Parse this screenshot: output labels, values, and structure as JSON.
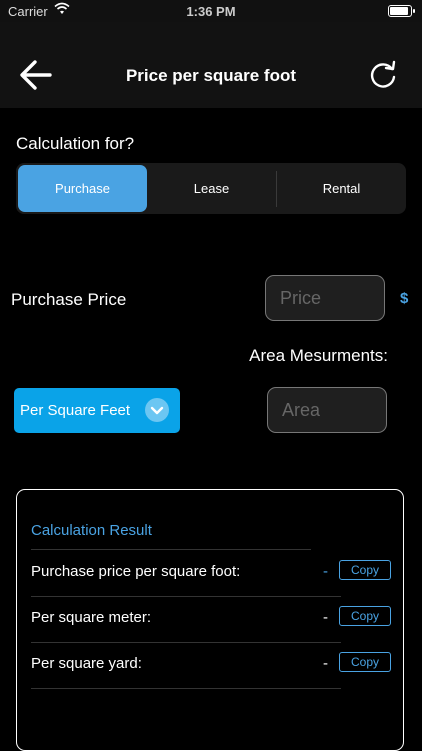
{
  "status_bar": {
    "carrier": "Carrier",
    "time": "1:36 PM"
  },
  "nav": {
    "title": "Price per square foot",
    "back_icon": "arrow-left-icon",
    "refresh_icon": "refresh-icon"
  },
  "calc": {
    "label": "Calculation for?",
    "segments": [
      {
        "label": "Purchase",
        "active": true
      },
      {
        "label": "Lease",
        "active": false
      },
      {
        "label": "Rental",
        "active": false
      }
    ]
  },
  "price": {
    "label": "Purchase Price",
    "placeholder": "Price",
    "currency": "$"
  },
  "area": {
    "label": "Area Mesurments:",
    "placeholder": "Area",
    "unit_selected": "Per Square Feet"
  },
  "result": {
    "title": "Calculation Result",
    "rows": [
      {
        "label": "Purchase price per square foot:",
        "value": "-",
        "copy": "Copy"
      },
      {
        "label": "Per square meter:",
        "value": "-",
        "copy": "Copy"
      },
      {
        "label": "Per square yard:",
        "value": "-",
        "copy": "Copy"
      }
    ]
  },
  "colors": {
    "accent": "#4aa3e3",
    "dropdown": "#0aa3e8",
    "background": "#000000",
    "navbar": "#121212"
  }
}
